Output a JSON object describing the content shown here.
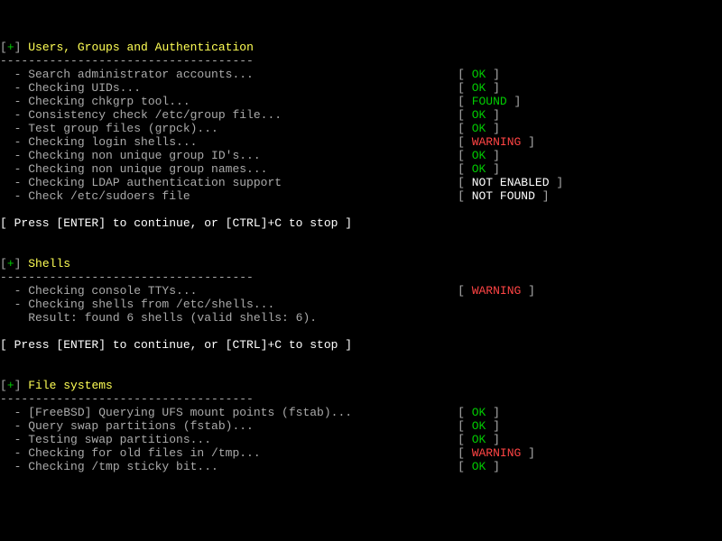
{
  "statusCol": 65,
  "labels": {
    "OK": "OK",
    "FOUND": "FOUND",
    "WARNING": "WARNING",
    "NOT_ENABLED": "NOT ENABLED",
    "NOT_FOUND": "NOT FOUND"
  },
  "prompt": "[ Press [ENTER] to continue, or [CTRL]+C to stop ]",
  "sections": [
    {
      "title": "Users, Groups and Authentication",
      "lines": [
        {
          "text": "Search administrator accounts...",
          "status": "OK"
        },
        {
          "text": "Checking UIDs...",
          "status": "OK"
        },
        {
          "text": "Checking chkgrp tool...",
          "status": "FOUND"
        },
        {
          "text": "Consistency check /etc/group file...",
          "status": "OK"
        },
        {
          "text": "Test group files (grpck)...",
          "status": "OK"
        },
        {
          "text": "Checking login shells...",
          "status": "WARNING"
        },
        {
          "text": "Checking non unique group ID's...",
          "status": "OK"
        },
        {
          "text": "Checking non unique group names...",
          "status": "OK"
        },
        {
          "text": "Checking LDAP authentication support",
          "status": "NOT_ENABLED"
        },
        {
          "text": "Check /etc/sudoers file",
          "status": "NOT_FOUND"
        }
      ],
      "promptAfter": true
    },
    {
      "title": "Shells",
      "lines": [
        {
          "text": "Checking console TTYs...",
          "status": "WARNING"
        },
        {
          "text": "Checking shells from /etc/shells..."
        },
        {
          "text": "Result: found 6 shells (valid shells: 6).",
          "indent": 4,
          "noDash": true
        }
      ],
      "promptAfter": true
    },
    {
      "title": "File systems",
      "lines": [
        {
          "text": "[FreeBSD] Querying UFS mount points (fstab)...",
          "status": "OK"
        },
        {
          "text": "Query swap partitions (fstab)...",
          "status": "OK"
        },
        {
          "text": "Testing swap partitions...",
          "status": "OK"
        },
        {
          "text": "Checking for old files in /tmp...",
          "status": "WARNING"
        },
        {
          "text": "Checking /tmp sticky bit...",
          "status": "OK"
        }
      ],
      "promptAfter": false
    }
  ]
}
